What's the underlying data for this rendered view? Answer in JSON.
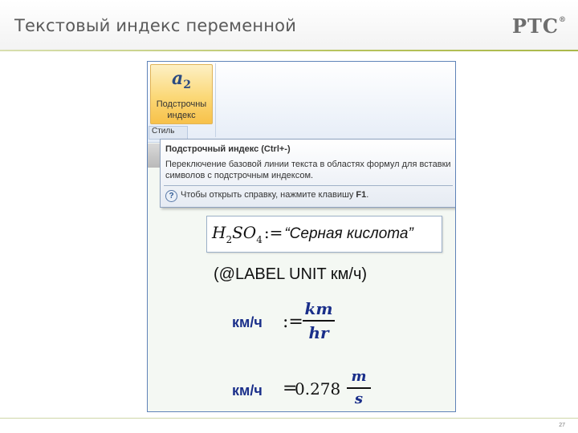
{
  "slide": {
    "title": "Текстовый индекс переменной",
    "logo": "PTC",
    "logo_mark": "®",
    "page_number": "27"
  },
  "ribbon": {
    "subscript_icon_letter": "a",
    "subscript_icon_digit": "2",
    "subscript_button_label_1": "Подстрочны",
    "subscript_button_label_2": "индекс",
    "group_label": "Стиль"
  },
  "tooltip": {
    "title": "Подстрочный индекс (Ctrl+-)",
    "description": "Переключение базовой линии текста в областях формул для вставки символов с подстрочным индексом.",
    "help_icon": "?",
    "help_text_prefix": "Чтобы открыть справку, нажмите клавишу",
    "help_key": "F1",
    "help_text_suffix": "."
  },
  "worksheet": {
    "formula": {
      "var1": "H",
      "var1_sub": "2",
      "var2": "SO",
      "var2_sub": "4",
      "assign": ":=",
      "string_value": "“Серная кислота”"
    },
    "label_line": "(@LABEL UNIT км/ч)",
    "eq1": {
      "unit": "км/ч",
      "op": ":=",
      "numerator": "km",
      "denominator": "hr"
    },
    "eq2": {
      "unit": "км/ч",
      "op": "=",
      "value": "0.278",
      "numerator": "m",
      "denominator": "s"
    }
  },
  "colors": {
    "accent": "#b7c35c",
    "unit_blue": "#1a2f8a",
    "ribbon_highlight": "#fbd877"
  }
}
